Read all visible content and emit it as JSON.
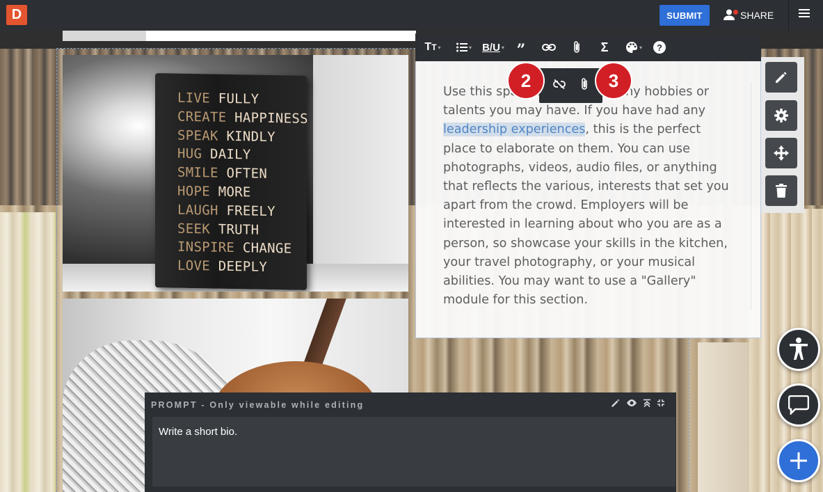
{
  "app": {
    "logo_letter": "D",
    "submit_label": "SUBMIT",
    "share_label": "SHARE",
    "colors": {
      "topbar": "#2c2f33",
      "submit": "#2e6fd8",
      "logo": "#e3552e",
      "badge": "#d21f26",
      "add_button": "#2e6fd8"
    }
  },
  "photo_sign": {
    "lines": [
      {
        "a": "LIVE",
        "b": "FULLY"
      },
      {
        "a": "CREATE",
        "b": "HAPPINESS"
      },
      {
        "a": "SPEAK",
        "b": "KINDLY"
      },
      {
        "a": "HUG",
        "b": "DAILY"
      },
      {
        "a": "SMILE",
        "b": "OFTEN"
      },
      {
        "a": "HOPE",
        "b": "MORE"
      },
      {
        "a": "LAUGH",
        "b": "FREELY"
      },
      {
        "a": "SEEK",
        "b": "TRUTH"
      },
      {
        "a": "INSPIRE",
        "b": "CHANGE"
      },
      {
        "a": "LOVE",
        "b": "DEEPLY"
      }
    ]
  },
  "editor": {
    "toolbar": [
      "text-size-icon",
      "list-icon",
      "bold-underline-icon",
      "quote-icon",
      "link-icon",
      "attachment-icon",
      "sigma-icon",
      "palette-icon",
      "help-icon"
    ],
    "bold_underline_label": "B/U",
    "text_before": "Use this space to talk about any hobbies or talents you may have. If you have had any ",
    "text_link": "leadership experiences",
    "text_after": ", this is the perfect place to elaborate on them. You can use photographs, videos, audio files, or anything that reflects the various, interests that set you apart from the crowd. Employers will be interested in learning about who you are as a person, so showcase your skills in the kitchen, your travel photography, or your musical abilities. You may want to use a \"Gallery\" module for this section.",
    "mini_toolbar": [
      "unlink-icon",
      "attachment-icon"
    ],
    "badges": [
      "2",
      "3"
    ]
  },
  "side_tools": [
    "pencil-icon",
    "gear-icon",
    "move-icon",
    "trash-icon"
  ],
  "fabs": [
    "accessibility-icon",
    "chat-icon",
    "plus-icon"
  ],
  "prompt": {
    "header": "PROMPT - Only viewable while editing",
    "icons": [
      "pencil-icon",
      "eye-icon",
      "collapse-icon",
      "drag-icon"
    ],
    "text": "Write a short bio."
  }
}
